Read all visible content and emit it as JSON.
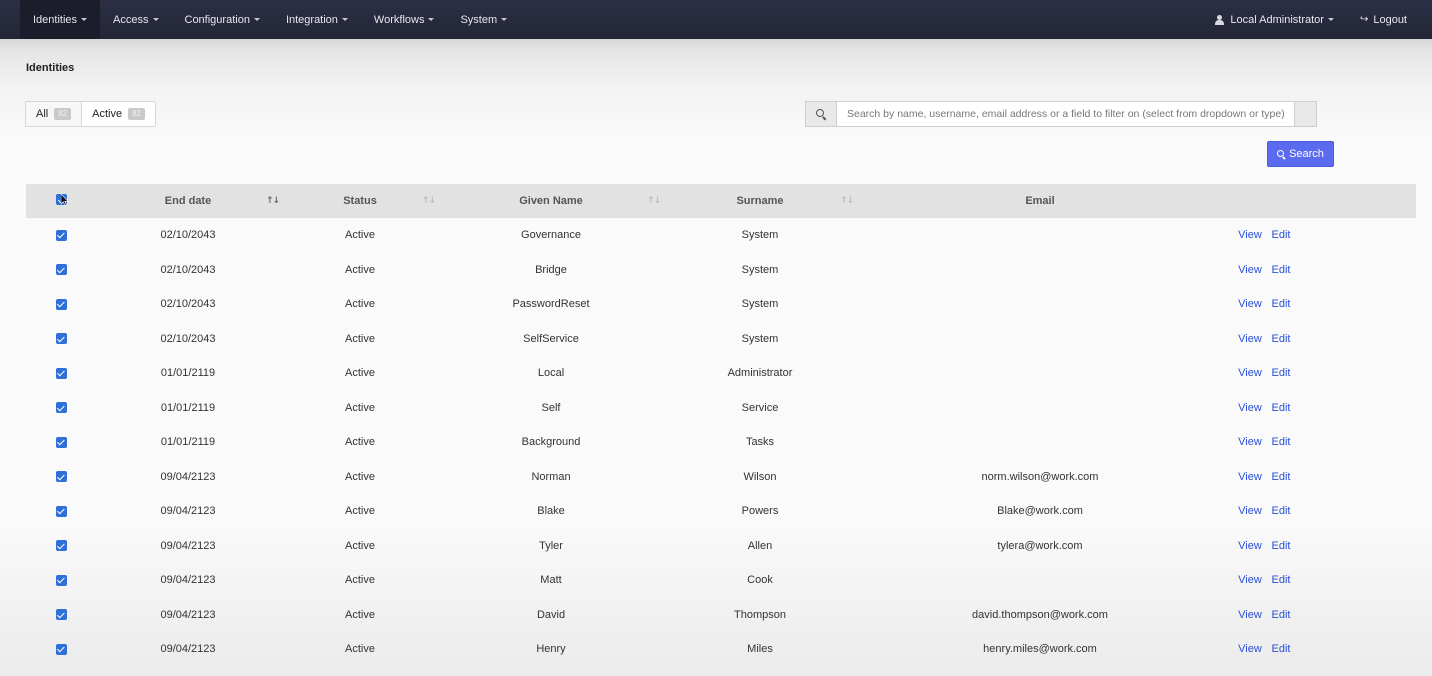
{
  "nav": {
    "items": [
      {
        "label": "Identities",
        "active": true
      },
      {
        "label": "Access"
      },
      {
        "label": "Configuration"
      },
      {
        "label": "Integration"
      },
      {
        "label": "Workflows"
      },
      {
        "label": "System"
      }
    ],
    "user_label": "Local Administrator",
    "logout_label": "Logout"
  },
  "page": {
    "title": "Identities"
  },
  "filters": {
    "all_label": "All",
    "all_count": "82",
    "active_label": "Active",
    "active_count": "82"
  },
  "search": {
    "placeholder": "Search by name, username, email address or a field to filter on (select from dropdown or type)",
    "button_label": "Search"
  },
  "table": {
    "columns": {
      "end_date": "End date",
      "status": "Status",
      "given_name": "Given Name",
      "surname": "Surname",
      "email": "Email"
    },
    "view_label": "View",
    "edit_label": "Edit",
    "rows": [
      {
        "end_date": "02/10/2043",
        "status": "Active",
        "given_name": "Governance",
        "surname": "System",
        "email": ""
      },
      {
        "end_date": "02/10/2043",
        "status": "Active",
        "given_name": "Bridge",
        "surname": "System",
        "email": ""
      },
      {
        "end_date": "02/10/2043",
        "status": "Active",
        "given_name": "PasswordReset",
        "surname": "System",
        "email": ""
      },
      {
        "end_date": "02/10/2043",
        "status": "Active",
        "given_name": "SelfService",
        "surname": "System",
        "email": ""
      },
      {
        "end_date": "01/01/2119",
        "status": "Active",
        "given_name": "Local",
        "surname": "Administrator",
        "email": ""
      },
      {
        "end_date": "01/01/2119",
        "status": "Active",
        "given_name": "Self",
        "surname": "Service",
        "email": ""
      },
      {
        "end_date": "01/01/2119",
        "status": "Active",
        "given_name": "Background",
        "surname": "Tasks",
        "email": ""
      },
      {
        "end_date": "09/04/2123",
        "status": "Active",
        "given_name": "Norman",
        "surname": "Wilson",
        "email": "norm.wilson@work.com"
      },
      {
        "end_date": "09/04/2123",
        "status": "Active",
        "given_name": "Blake",
        "surname": "Powers",
        "email": "Blake@work.com"
      },
      {
        "end_date": "09/04/2123",
        "status": "Active",
        "given_name": "Tyler",
        "surname": "Allen",
        "email": "tylera@work.com"
      },
      {
        "end_date": "09/04/2123",
        "status": "Active",
        "given_name": "Matt",
        "surname": "Cook",
        "email": ""
      },
      {
        "end_date": "09/04/2123",
        "status": "Active",
        "given_name": "David",
        "surname": "Thompson",
        "email": "david.thompson@work.com"
      },
      {
        "end_date": "09/04/2123",
        "status": "Active",
        "given_name": "Henry",
        "surname": "Miles",
        "email": "henry.miles@work.com"
      }
    ]
  },
  "colors": {
    "accent": "#5b6bf0",
    "navbar": "#2c2f44",
    "link": "#2a4fd6",
    "checkbox": "#2f6fd8"
  }
}
